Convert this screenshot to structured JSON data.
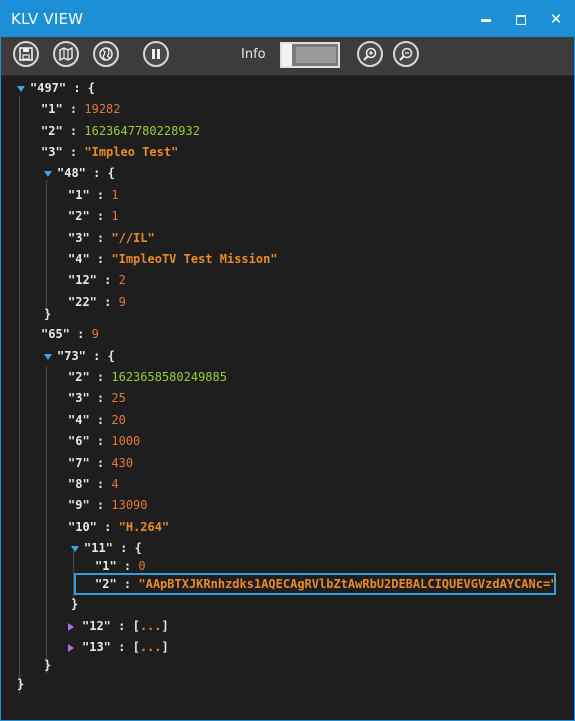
{
  "window": {
    "title": "KLV VIEW",
    "controls": {
      "minimize": "▁",
      "maximize": "□",
      "close": "✕"
    }
  },
  "toolbar": {
    "info_label": "Info"
  },
  "tree": {
    "r497": {
      "key": "\"497\"",
      "sep": " : {"
    },
    "r497_1": {
      "key": "\"1\"",
      "sep": " : ",
      "val": "19282"
    },
    "r497_2": {
      "key": "\"2\"",
      "sep": " : ",
      "val": "1623647780228932"
    },
    "r497_3": {
      "key": "\"3\"",
      "sep": " : ",
      "val": "\"Impleo Test\""
    },
    "r48": {
      "key": "\"48\"",
      "sep": " : {"
    },
    "r48_1": {
      "key": "\"1\"",
      "sep": " : ",
      "val": "1"
    },
    "r48_2": {
      "key": "\"2\"",
      "sep": " : ",
      "val": "1"
    },
    "r48_3": {
      "key": "\"3\"",
      "sep": " : ",
      "val": "\"//IL\""
    },
    "r48_4": {
      "key": "\"4\"",
      "sep": " : ",
      "val": "\"ImpleoTV Test Mission\""
    },
    "r48_12": {
      "key": "\"12\"",
      "sep": " : ",
      "val": "2"
    },
    "r48_22": {
      "key": "\"22\"",
      "sep": " : ",
      "val": "9"
    },
    "r48_close": {
      "text": "}"
    },
    "r65": {
      "key": "\"65\"",
      "sep": " : ",
      "val": "9"
    },
    "r73": {
      "key": "\"73\"",
      "sep": " : {"
    },
    "r73_2": {
      "key": "\"2\"",
      "sep": " : ",
      "val": "1623658580249885"
    },
    "r73_3": {
      "key": "\"3\"",
      "sep": " : ",
      "val": "25"
    },
    "r73_4": {
      "key": "\"4\"",
      "sep": " : ",
      "val": "20"
    },
    "r73_6": {
      "key": "\"6\"",
      "sep": " : ",
      "val": "1000"
    },
    "r73_7": {
      "key": "\"7\"",
      "sep": " : ",
      "val": "430"
    },
    "r73_8": {
      "key": "\"8\"",
      "sep": " : ",
      "val": "4"
    },
    "r73_9": {
      "key": "\"9\"",
      "sep": " : ",
      "val": "13090"
    },
    "r73_10": {
      "key": "\"10\"",
      "sep": " : ",
      "val": "\"H.264\""
    },
    "r11": {
      "key": "\"11\"",
      "sep": " : {"
    },
    "r11_1": {
      "key": "\"1\"",
      "sep": " : ",
      "val": "0"
    },
    "r11_2": {
      "key": "\"2\"",
      "sep": " : ",
      "val": "\"AApBTXJKRnhzdks1AQECAgRVlbZtAwRbU2DEBALCIQUEVGVzdAYCANc=\""
    },
    "r11_close": {
      "text": "}"
    },
    "r12": {
      "key": "\"12\"",
      "sep": " : [",
      "ellipsis": "...",
      "close": "]"
    },
    "r13": {
      "key": "\"13\"",
      "sep": " : [",
      "ellipsis": "...",
      "close": "]"
    },
    "r73_close": {
      "text": "}"
    },
    "root_close": {
      "text": "}"
    }
  },
  "colors": {
    "accent": "#1c8fd6",
    "number": "#e2783a",
    "long_number": "#9acd32",
    "string": "#e88a28",
    "key": "#e8e8e8",
    "selection": "#2f9fe0"
  },
  "icons": [
    "save-icon",
    "map-icon",
    "globe-icon",
    "pause-icon",
    "zoom-in-icon",
    "zoom-out-icon"
  ]
}
